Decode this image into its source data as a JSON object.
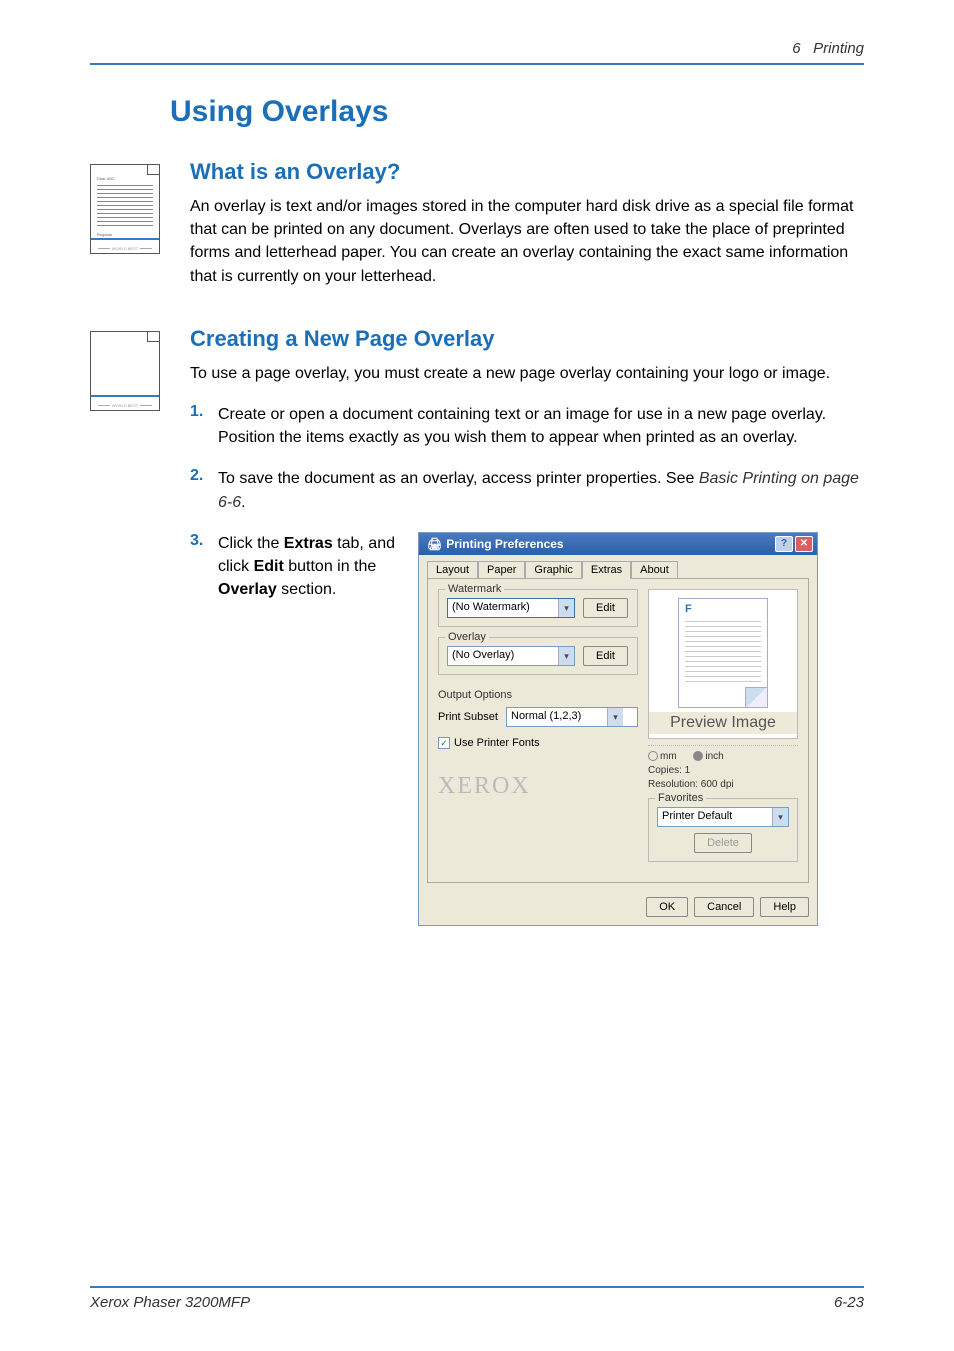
{
  "header": {
    "chapter_num": "6",
    "chapter_title": "Printing"
  },
  "h1": "Using Overlays",
  "sections": {
    "what_is": {
      "title": "What is an Overlay?",
      "para": "An overlay is text and/or images stored in the computer hard disk drive as a special file format that can be printed on any document. Overlays are often used to take the place of preprinted forms and letterhead paper. You can create an overlay containing the exact same information that is currently on your letterhead.",
      "thumb": {
        "company": "Dear ABC",
        "regards": "Regards",
        "footer": "WORLD BEST"
      }
    },
    "creating": {
      "title": "Creating a New Page Overlay",
      "intro": "To use a page overlay, you must create a new page overlay containing your logo or image.",
      "steps": [
        {
          "num": "1.",
          "text": "Create or open a document containing text or an image for use in a new page overlay. Position the items exactly as you wish them to appear when printed as an overlay."
        },
        {
          "num": "2.",
          "text_pre": "To save the document as an overlay, access printer properties. See ",
          "text_italic": "Basic Printing on page 6-6",
          "text_post": "."
        },
        {
          "num": "3.",
          "text_1": "Click the ",
          "bold_1": "Extras",
          "text_2": " tab, and click ",
          "bold_2": "Edit",
          "text_3": " button in the ",
          "bold_3": "Over­lay",
          "text_4": " section."
        }
      ],
      "thumb_footer": "WORLD BEST"
    }
  },
  "dialog": {
    "title": "Printing Preferences",
    "tabs": [
      "Layout",
      "Paper",
      "Graphic",
      "Extras",
      "About"
    ],
    "active_tab": 3,
    "watermark": {
      "label": "Watermark",
      "value": "(No Watermark)",
      "button": "Edit"
    },
    "overlay": {
      "label": "Overlay",
      "value": "(No Overlay)",
      "button": "Edit"
    },
    "output": {
      "label": "Output Options",
      "subset_label": "Print Subset",
      "subset_value": "Normal (1,2,3)"
    },
    "checkbox": {
      "label": "Use Printer Fonts",
      "checked": true
    },
    "preview": {
      "letter": "F",
      "overlay_label": "Preview Image"
    },
    "info": {
      "unit_mm": "mm",
      "unit_inch": "inch",
      "copies": "Copies: 1",
      "resolution": "Resolution: 600 dpi"
    },
    "favorites": {
      "label": "Favorites",
      "value": "Printer Default",
      "delete": "Delete"
    },
    "logo": "XEROX",
    "buttons": {
      "ok": "OK",
      "cancel": "Cancel",
      "help": "Help"
    }
  },
  "footer": {
    "left": "Xerox Phaser 3200MFP",
    "right": "6-23"
  }
}
